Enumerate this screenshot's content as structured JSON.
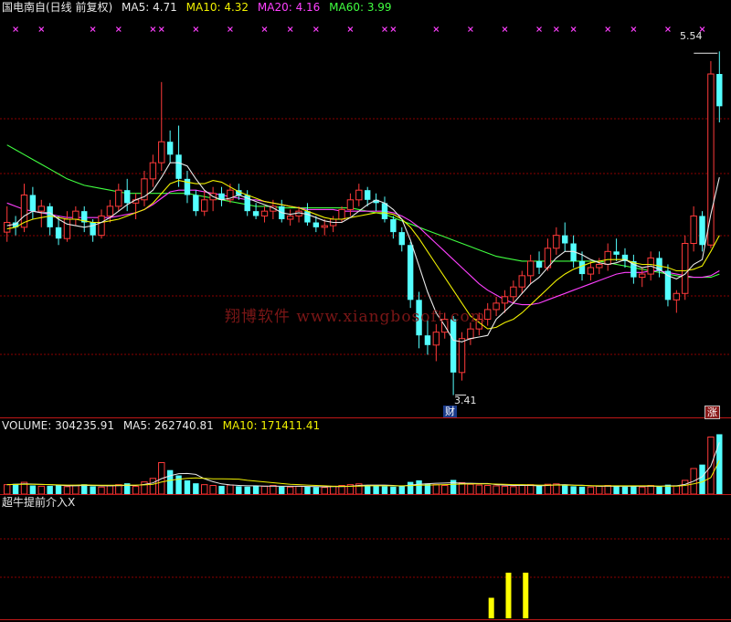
{
  "header": {
    "stock_title": "国电南自(日线 前复权)",
    "ma5": "MA5: 4.71",
    "ma10": "MA10: 4.32",
    "ma20": "MA20: 4.16",
    "ma60": "MA60: 3.99"
  },
  "volume_header": {
    "volume": "VOLUME: 304235.91",
    "ma5": "MA5: 262740.81",
    "ma10": "MA10: 171411.41"
  },
  "indicator_header": {
    "title": "超牛提前介入X"
  },
  "watermark": "翔博软件 www.xiangbosoft.com",
  "annotations": {
    "high_price": "5.54",
    "low_price": "3.41",
    "finance_badge": "财",
    "limit_badge": "涨"
  },
  "colors": {
    "up": "#ff3a3a",
    "down": "#54ffff",
    "ma5": "#e8e8e8",
    "ma10": "#f0f000",
    "ma20": "#ff40ff",
    "ma60": "#40ff40",
    "grid": "#8b0000",
    "signal": "#ffff00"
  },
  "chart_data": [
    {
      "type": "candlestick",
      "title": "国电南自(日线 前复权)",
      "y_range": [
        3.3,
        5.7
      ],
      "candles": [
        [
          4.42,
          4.58,
          4.36,
          4.48
        ],
        [
          4.48,
          4.52,
          4.4,
          4.45
        ],
        [
          4.45,
          4.72,
          4.42,
          4.65
        ],
        [
          4.65,
          4.7,
          4.5,
          4.55
        ],
        [
          4.55,
          4.62,
          4.45,
          4.58
        ],
        [
          4.58,
          4.6,
          4.4,
          4.45
        ],
        [
          4.45,
          4.52,
          4.34,
          4.38
        ],
        [
          4.38,
          4.55,
          4.36,
          4.5
        ],
        [
          4.5,
          4.58,
          4.46,
          4.55
        ],
        [
          4.55,
          4.58,
          4.42,
          4.48
        ],
        [
          4.48,
          4.5,
          4.36,
          4.4
        ],
        [
          4.4,
          4.56,
          4.38,
          4.52
        ],
        [
          4.52,
          4.62,
          4.48,
          4.58
        ],
        [
          4.58,
          4.72,
          4.55,
          4.68
        ],
        [
          4.68,
          4.75,
          4.55,
          4.6
        ],
        [
          4.6,
          4.66,
          4.5,
          4.62
        ],
        [
          4.62,
          4.8,
          4.58,
          4.75
        ],
        [
          4.75,
          4.9,
          4.7,
          4.85
        ],
        [
          4.85,
          5.35,
          4.8,
          4.98
        ],
        [
          4.98,
          5.05,
          4.85,
          4.9
        ],
        [
          4.9,
          5.08,
          4.7,
          4.75
        ],
        [
          4.75,
          4.8,
          4.6,
          4.65
        ],
        [
          4.65,
          4.68,
          4.52,
          4.55
        ],
        [
          4.55,
          4.68,
          4.52,
          4.62
        ],
        [
          4.62,
          4.7,
          4.55,
          4.66
        ],
        [
          4.66,
          4.7,
          4.58,
          4.62
        ],
        [
          4.62,
          4.72,
          4.6,
          4.68
        ],
        [
          4.68,
          4.72,
          4.62,
          4.65
        ],
        [
          4.65,
          4.68,
          4.52,
          4.55
        ],
        [
          4.55,
          4.6,
          4.5,
          4.52
        ],
        [
          4.52,
          4.58,
          4.48,
          4.55
        ],
        [
          4.55,
          4.62,
          4.5,
          4.58
        ],
        [
          4.58,
          4.62,
          4.48,
          4.5
        ],
        [
          4.5,
          4.56,
          4.46,
          4.52
        ],
        [
          4.52,
          4.58,
          4.48,
          4.55
        ],
        [
          4.55,
          4.6,
          4.46,
          4.48
        ],
        [
          4.48,
          4.52,
          4.42,
          4.45
        ],
        [
          4.45,
          4.5,
          4.4,
          4.46
        ],
        [
          4.46,
          4.52,
          4.42,
          4.5
        ],
        [
          4.5,
          4.58,
          4.48,
          4.56
        ],
        [
          4.56,
          4.66,
          4.52,
          4.62
        ],
        [
          4.62,
          4.72,
          4.58,
          4.68
        ],
        [
          4.68,
          4.7,
          4.58,
          4.62
        ],
        [
          4.62,
          4.66,
          4.55,
          4.6
        ],
        [
          4.6,
          4.64,
          4.48,
          4.5
        ],
        [
          4.5,
          4.52,
          4.38,
          4.42
        ],
        [
          4.42,
          4.45,
          4.3,
          4.34
        ],
        [
          4.34,
          4.36,
          3.95,
          4.0
        ],
        [
          4.0,
          4.05,
          3.7,
          3.78
        ],
        [
          3.78,
          3.88,
          3.66,
          3.72
        ],
        [
          3.72,
          3.85,
          3.62,
          3.8
        ],
        [
          3.8,
          3.92,
          3.76,
          3.88
        ],
        [
          3.88,
          3.9,
          3.41,
          3.55
        ],
        [
          3.55,
          3.8,
          3.5,
          3.76
        ],
        [
          3.76,
          3.86,
          3.72,
          3.82
        ],
        [
          3.82,
          3.92,
          3.78,
          3.88
        ],
        [
          3.88,
          3.98,
          3.84,
          3.94
        ],
        [
          3.94,
          4.02,
          3.9,
          3.98
        ],
        [
          3.98,
          4.06,
          3.92,
          4.02
        ],
        [
          4.02,
          4.12,
          3.98,
          4.08
        ],
        [
          4.08,
          4.18,
          4.04,
          4.15
        ],
        [
          4.15,
          4.28,
          4.1,
          4.24
        ],
        [
          4.24,
          4.3,
          4.16,
          4.2
        ],
        [
          4.2,
          4.38,
          4.18,
          4.32
        ],
        [
          4.32,
          4.45,
          4.28,
          4.4
        ],
        [
          4.4,
          4.48,
          4.3,
          4.35
        ],
        [
          4.35,
          4.4,
          4.2,
          4.24
        ],
        [
          4.24,
          4.3,
          4.12,
          4.16
        ],
        [
          4.16,
          4.24,
          4.12,
          4.2
        ],
        [
          4.2,
          4.26,
          4.16,
          4.22
        ],
        [
          4.22,
          4.35,
          4.18,
          4.3
        ],
        [
          4.3,
          4.38,
          4.24,
          4.28
        ],
        [
          4.28,
          4.32,
          4.2,
          4.24
        ],
        [
          4.24,
          4.28,
          4.1,
          4.14
        ],
        [
          4.14,
          4.2,
          4.08,
          4.16
        ],
        [
          4.16,
          4.3,
          4.12,
          4.26
        ],
        [
          4.26,
          4.3,
          4.14,
          4.18
        ],
        [
          4.18,
          4.22,
          3.96,
          4.0
        ],
        [
          4.0,
          4.06,
          3.92,
          4.04
        ],
        [
          4.04,
          4.4,
          4.0,
          4.35
        ],
        [
          4.35,
          4.58,
          4.3,
          4.52
        ],
        [
          4.52,
          4.55,
          4.3,
          4.34
        ],
        [
          4.34,
          5.48,
          4.32,
          5.4
        ],
        [
          5.4,
          5.54,
          5.1,
          5.2
        ]
      ],
      "ma5_series": [
        4.46,
        4.47,
        4.52,
        4.55,
        4.54,
        4.54,
        4.5,
        4.47,
        4.46,
        4.45,
        4.46,
        4.48,
        4.51,
        4.55,
        4.59,
        4.62,
        4.64,
        4.68,
        4.76,
        4.85,
        4.85,
        4.83,
        4.75,
        4.68,
        4.64,
        4.62,
        4.63,
        4.65,
        4.63,
        4.61,
        4.59,
        4.57,
        4.54,
        4.53,
        4.54,
        4.53,
        4.51,
        4.49,
        4.48,
        4.48,
        4.51,
        4.55,
        4.59,
        4.62,
        4.6,
        4.56,
        4.5,
        4.37,
        4.21,
        4.05,
        3.92,
        3.84,
        3.75,
        3.74,
        3.76,
        3.77,
        3.78,
        3.88,
        3.93,
        3.98,
        4.04,
        4.1,
        4.14,
        4.2,
        4.26,
        4.3,
        4.3,
        4.28,
        4.25,
        4.23,
        4.22,
        4.23,
        4.25,
        4.22,
        4.2,
        4.21,
        4.19,
        4.15,
        4.13,
        4.16,
        4.22,
        4.25,
        4.53,
        4.76
      ],
      "ma10_series": [
        4.44,
        4.45,
        4.48,
        4.5,
        4.51,
        4.52,
        4.51,
        4.5,
        4.5,
        4.49,
        4.48,
        4.48,
        4.49,
        4.5,
        4.52,
        4.54,
        4.56,
        4.6,
        4.66,
        4.72,
        4.74,
        4.73,
        4.72,
        4.72,
        4.74,
        4.73,
        4.7,
        4.67,
        4.65,
        4.63,
        4.61,
        4.6,
        4.59,
        4.58,
        4.57,
        4.55,
        4.53,
        4.51,
        4.5,
        4.5,
        4.51,
        4.52,
        4.53,
        4.54,
        4.54,
        4.53,
        4.5,
        4.45,
        4.38,
        4.3,
        4.22,
        4.14,
        4.06,
        3.98,
        3.9,
        3.86,
        3.82,
        3.83,
        3.86,
        3.88,
        3.92,
        3.97,
        4.02,
        4.07,
        4.12,
        4.16,
        4.19,
        4.21,
        4.23,
        4.24,
        4.25,
        4.25,
        4.25,
        4.23,
        4.22,
        4.22,
        4.21,
        4.2,
        4.18,
        4.18,
        4.19,
        4.21,
        4.3,
        4.4
      ],
      "ma20_series": [
        4.6,
        4.58,
        4.56,
        4.55,
        4.54,
        4.53,
        4.52,
        4.51,
        4.51,
        4.51,
        4.51,
        4.51,
        4.51,
        4.52,
        4.53,
        4.54,
        4.56,
        4.59,
        4.63,
        4.67,
        4.68,
        4.68,
        4.68,
        4.67,
        4.66,
        4.65,
        4.64,
        4.63,
        4.62,
        4.62,
        4.61,
        4.6,
        4.59,
        4.58,
        4.57,
        4.56,
        4.56,
        4.56,
        4.56,
        4.55,
        4.55,
        4.55,
        4.55,
        4.55,
        4.55,
        4.54,
        4.52,
        4.49,
        4.45,
        4.4,
        4.35,
        4.3,
        4.25,
        4.2,
        4.15,
        4.1,
        4.06,
        4.03,
        4.0,
        3.98,
        3.97,
        3.97,
        3.98,
        4.0,
        4.02,
        4.04,
        4.06,
        4.08,
        4.1,
        4.12,
        4.14,
        4.16,
        4.17,
        4.17,
        4.17,
        4.18,
        4.18,
        4.17,
        4.16,
        4.15,
        4.14,
        4.14,
        4.15,
        4.18
      ],
      "ma60_series": [
        4.96,
        4.93,
        4.9,
        4.87,
        4.84,
        4.81,
        4.78,
        4.75,
        4.73,
        4.71,
        4.7,
        4.69,
        4.68,
        4.67,
        4.66,
        4.66,
        4.66,
        4.66,
        4.66,
        4.66,
        4.66,
        4.66,
        4.65,
        4.64,
        4.63,
        4.62,
        4.61,
        4.6,
        4.59,
        4.58,
        4.58,
        4.58,
        4.57,
        4.57,
        4.57,
        4.57,
        4.57,
        4.57,
        4.57,
        4.57,
        4.57,
        4.56,
        4.55,
        4.54,
        4.53,
        4.51,
        4.49,
        4.47,
        4.45,
        4.43,
        4.41,
        4.39,
        4.37,
        4.35,
        4.33,
        4.31,
        4.29,
        4.27,
        4.26,
        4.25,
        4.24,
        4.24,
        4.24,
        4.24,
        4.24,
        4.24,
        4.24,
        4.24,
        4.24,
        4.24,
        4.23,
        4.22,
        4.21,
        4.2,
        4.19,
        4.18,
        4.17,
        4.16,
        4.15,
        4.14,
        4.14,
        4.14,
        4.14,
        4.16
      ],
      "signal_marks": [
        1,
        4,
        10,
        13,
        17,
        18,
        22,
        26,
        30,
        33,
        36,
        40,
        44,
        45,
        50,
        54,
        58,
        62,
        64,
        66,
        70,
        73,
        77,
        81
      ],
      "high_label": "5.54",
      "low_label": "3.41"
    },
    {
      "type": "bar",
      "title": "VOLUME",
      "values": [
        48,
        52,
        60,
        44,
        40,
        42,
        46,
        38,
        44,
        50,
        40,
        36,
        42,
        48,
        55,
        40,
        62,
        80,
        160,
        122,
        95,
        70,
        55,
        48,
        44,
        42,
        46,
        40,
        38,
        42,
        40,
        44,
        38,
        36,
        40,
        38,
        36,
        34,
        40,
        44,
        48,
        52,
        46,
        42,
        40,
        38,
        40,
        62,
        70,
        54,
        48,
        44,
        72,
        58,
        50,
        46,
        44,
        42,
        40,
        38,
        44,
        48,
        42,
        50,
        52,
        46,
        40,
        38,
        36,
        40,
        44,
        42,
        38,
        40,
        36,
        44,
        40,
        48,
        42,
        70,
        130,
        150,
        290,
        304
      ],
      "ma5_values": [
        48,
        50,
        52,
        51,
        49,
        48,
        46,
        42,
        42,
        44,
        44,
        42,
        42,
        43,
        44,
        44,
        49,
        57,
        79,
        93,
        104,
        105,
        100,
        78,
        63,
        52,
        47,
        44,
        42,
        42,
        41,
        41,
        40,
        40,
        40,
        39,
        38,
        37,
        38,
        38,
        40,
        44,
        46,
        46,
        46,
        44,
        41,
        46,
        50,
        53,
        55,
        56,
        58,
        55,
        55,
        54,
        54,
        48,
        46,
        44,
        44,
        44,
        42,
        44,
        47,
        48,
        46,
        45,
        42,
        40,
        40,
        40,
        40,
        40,
        40,
        40,
        40,
        42,
        42,
        49,
        66,
        88,
        142,
        263
      ],
      "ma10_values": [
        48,
        49,
        50,
        50,
        49,
        48,
        47,
        46,
        46,
        47,
        46,
        45,
        45,
        45,
        46,
        46,
        47,
        50,
        61,
        70,
        76,
        80,
        82,
        80,
        78,
        78,
        77,
        76,
        70,
        66,
        62,
        58,
        54,
        50,
        48,
        46,
        44,
        42,
        40,
        40,
        40,
        41,
        42,
        42,
        42,
        42,
        42,
        43,
        45,
        46,
        47,
        48,
        50,
        51,
        52,
        52,
        52,
        51,
        50,
        48,
        48,
        47,
        46,
        46,
        46,
        46,
        45,
        44,
        43,
        42,
        42,
        42,
        42,
        42,
        42,
        42,
        41,
        41,
        41,
        44,
        52,
        62,
        84,
        171
      ],
      "ylim": [
        0,
        320
      ]
    },
    {
      "type": "bar",
      "title": "超牛提前介入X",
      "categories_index": [
        56,
        58,
        60
      ],
      "values": [
        0.45,
        1.0,
        1.0
      ],
      "ylim": [
        0,
        1
      ]
    }
  ]
}
